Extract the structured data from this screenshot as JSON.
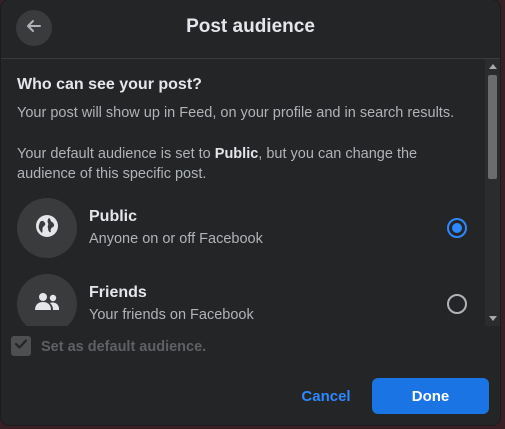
{
  "header": {
    "title": "Post audience",
    "back_icon": "arrow-left-icon"
  },
  "content": {
    "heading": "Who can see your post?",
    "description": "Your post will show up in Feed, on your profile and in search results.",
    "default_text_before": "Your default audience is set to ",
    "default_audience": "Public",
    "default_text_after": ", but you can change the audience of this specific post."
  },
  "options": [
    {
      "title": "Public",
      "subtitle": "Anyone on or off Facebook",
      "icon": "globe-icon",
      "selected": true
    },
    {
      "title": "Friends",
      "subtitle": "Your friends on Facebook",
      "icon": "friends-icon",
      "selected": false
    }
  ],
  "footer": {
    "default_checkbox_label": "Set as default audience.",
    "default_checkbox_checked": true,
    "cancel_label": "Cancel",
    "done_label": "Done"
  },
  "colors": {
    "background": "#242526",
    "accent": "#2d88ff",
    "primary_button": "#1b74e4",
    "text_primary": "#e4e6eb",
    "text_secondary": "#b0b3b8"
  }
}
